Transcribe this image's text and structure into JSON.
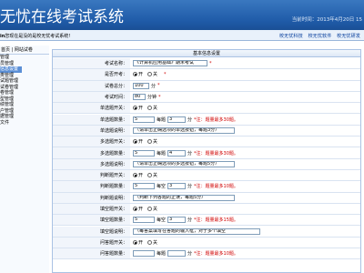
{
  "header": {
    "title": "无忧在线考试系统",
    "date": "当前时间：2013年4月20日  15"
  },
  "strip": {
    "welcome_prefix": "in",
    "welcome_text": "您现在是没的是校无忧考试系统!",
    "links": [
      "校无忧科技",
      "校无忧软件",
      "校无忧研发"
    ]
  },
  "sidebar": {
    "top": "首页 | 网站试卷",
    "items": [
      "管理",
      "员管理",
      "信息设置",
      "类管理",
      "试题管理",
      "试卷管理",
      "卷管理",
      "型管理",
      "绩管理",
      "户管理",
      "据管理",
      "文件"
    ],
    "active_index": 2
  },
  "panel": {
    "title": "基本信息设置",
    "rows": {
      "exam_name": {
        "label": "考试名称：",
        "value": "《计算机应用基础》期末考试",
        "star": "*"
      },
      "is_open": {
        "label": "是否开考：",
        "on": "开",
        "off": "关",
        "star": "*"
      },
      "total_score": {
        "label": "试卷总分：",
        "value": "100",
        "unit": "分",
        "star": "*"
      },
      "exam_time": {
        "label": "考试时间：",
        "value": "80",
        "unit": "分钟",
        "star": "*"
      },
      "single_switch": {
        "label": "单选题开关：",
        "on": "开",
        "off": "关"
      },
      "single_count": {
        "label": "单选题数量：",
        "value": "5",
        "per_label": "每题",
        "per_value": "3",
        "unit": "分",
        "note": "*注：题量最多30题。"
      },
      "single_desc": {
        "label": "单选题说明：",
        "value": "（请单击正确选项的单选按钮，每题3分）"
      },
      "multi_switch": {
        "label": "多选题开关：",
        "on": "开",
        "off": "关"
      },
      "multi_count": {
        "label": "多选题数量：",
        "value": "5",
        "per_label": "每题",
        "per_value": "4",
        "unit": "分",
        "note": "*注：题量最多30题。"
      },
      "multi_desc": {
        "label": "多选题说明：",
        "value": "（请单击正确选项的多选按钮，每题5分）"
      },
      "judge_switch": {
        "label": "判断题开关：",
        "on": "开",
        "off": "关"
      },
      "judge_count": {
        "label": "判断题数量：",
        "value": "5",
        "per_label": "每空",
        "per_value": "3",
        "unit": "分",
        "note": "*注：题量最多10题。"
      },
      "judge_desc": {
        "label": "判断题说明：",
        "value": "（判断下列各题的正误，每题5分）"
      },
      "fill_switch": {
        "label": "填空题开关：",
        "on": "开",
        "off": "关"
      },
      "fill_count": {
        "label": "填空题数量：",
        "value": "5",
        "per_label": "每空",
        "per_value": "3",
        "unit": "分",
        "note": "*注：题量最多15题。"
      },
      "fill_desc": {
        "label": "填空题说明：",
        "value": "（每答案填写在答题的输入框，对于多个填空"
      },
      "qa_switch": {
        "label": "问答题开关：",
        "on": "开",
        "off": "关"
      },
      "qa_count": {
        "label": "问答题数量：",
        "value": "",
        "per_label": "每题",
        "per_value": "",
        "unit": "分",
        "note": "*注：题量最多10题。"
      }
    }
  }
}
